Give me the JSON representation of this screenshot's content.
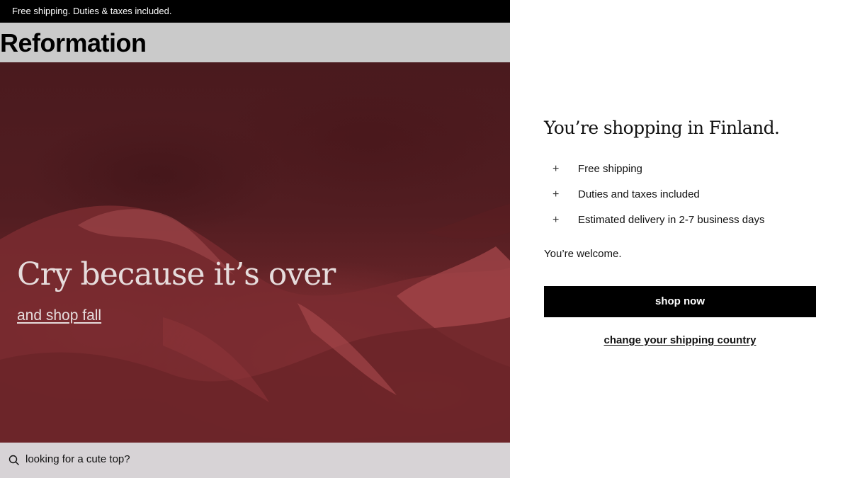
{
  "promo": {
    "text": "Free shipping. Duties & taxes included."
  },
  "header": {
    "logo": "Reformation"
  },
  "hero": {
    "title": "Cry because it’s over",
    "link": "and shop fall"
  },
  "search": {
    "placeholder": "looking for a cute top?",
    "icon": "search-icon"
  },
  "panel": {
    "title": "You’re shopping in Finland.",
    "benefits": [
      {
        "icon": "+",
        "label": "Free shipping"
      },
      {
        "icon": "+",
        "label": "Duties and taxes included"
      },
      {
        "icon": "+",
        "label": "Estimated delivery in 2-7 business days"
      }
    ],
    "welcome": "You’re welcome.",
    "shop_button": "shop now",
    "change_link": "change your shipping country"
  },
  "colors": {
    "promo_bg": "#000000",
    "header_bg": "#cacaca",
    "hero_tone": "#5a1f23",
    "button_bg": "#000000"
  }
}
